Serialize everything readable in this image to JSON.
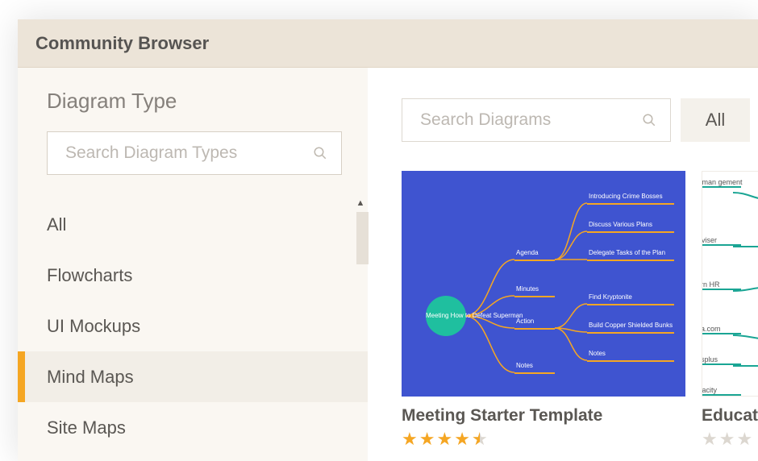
{
  "title": "Community Browser",
  "sidebar": {
    "heading": "Diagram Type",
    "search_placeholder": "Search Diagram Types",
    "items": [
      {
        "label": "All"
      },
      {
        "label": "Flowcharts"
      },
      {
        "label": "UI Mockups"
      },
      {
        "label": "Mind Maps",
        "selected": true
      },
      {
        "label": "Site Maps"
      }
    ]
  },
  "main": {
    "search_placeholder": "Search Diagrams",
    "filter_button": "All"
  },
  "cards": [
    {
      "title": "Meeting Starter Template",
      "rating": 4.5,
      "mindmap": {
        "center": "Meeting How to Defeat Superman",
        "branches": [
          "Agenda",
          "Minutes",
          "Action",
          "Notes"
        ],
        "leaves": [
          "Introducing Crime Bosses",
          "Discuss Various Plans",
          "Delegate Tasks of the Plan",
          "Find Kryptonite",
          "Build Copper Shielded Bunks",
          "Notes"
        ]
      }
    },
    {
      "title": "Educat",
      "rating_grey": 3,
      "items": [
        "Human\ngement",
        "Adviser",
        "earn HR",
        "nda.com",
        "tutsplus",
        "Udacity"
      ]
    }
  ]
}
